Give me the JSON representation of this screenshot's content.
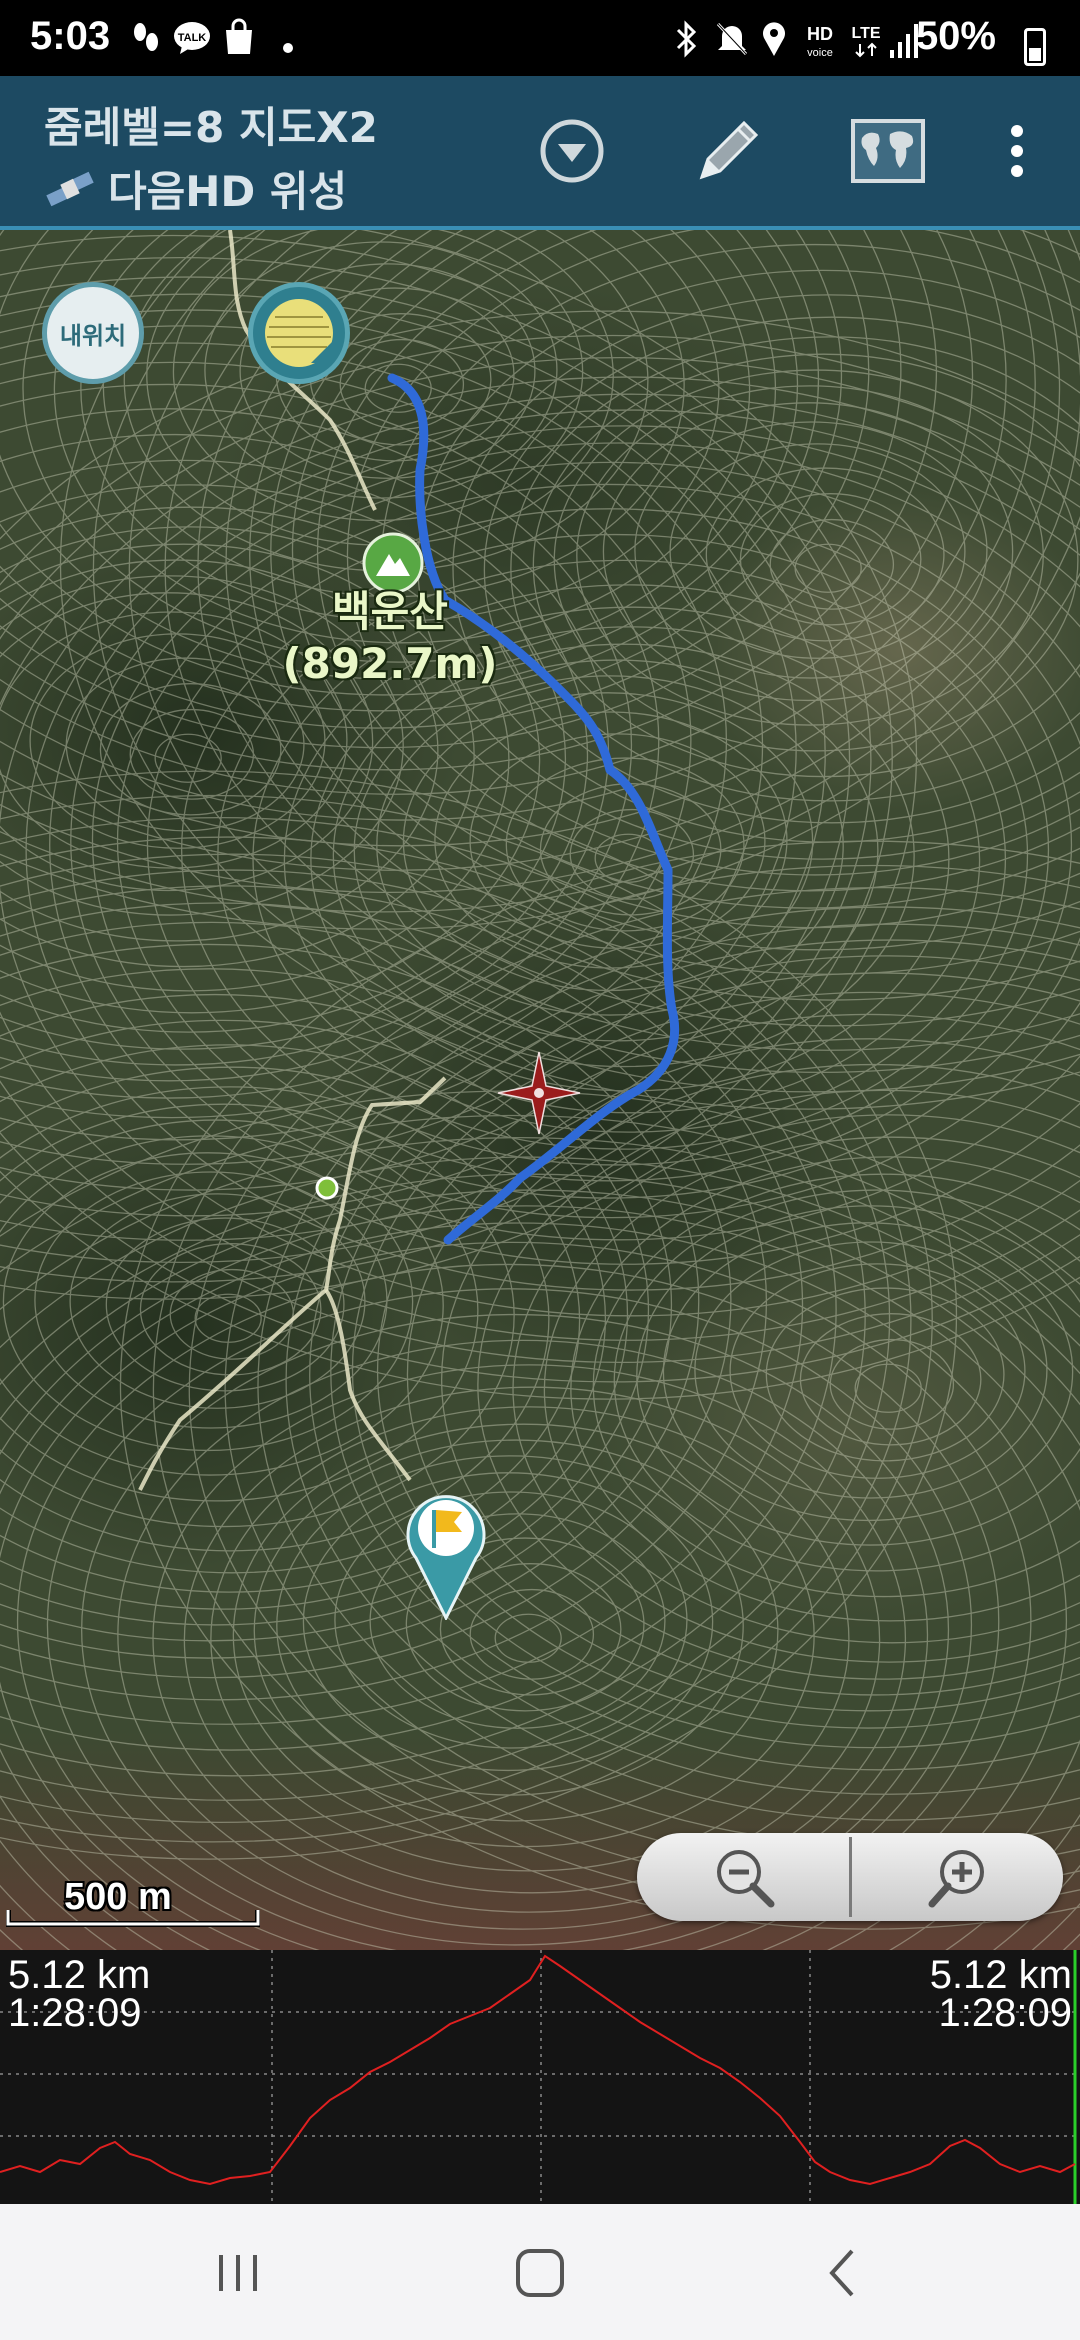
{
  "status_bar": {
    "time": "5:03",
    "battery": "50%",
    "icons": [
      "footprints-icon",
      "kakaotalk-icon",
      "shopping-bag-icon",
      "dot-icon",
      "bluetooth-icon",
      "mute-icon",
      "location-icon",
      "hd-voice-icon",
      "lte-icon",
      "signal-icon",
      "battery-icon"
    ]
  },
  "header": {
    "zoom_text": "줌레벨=8 지도X2",
    "map_source": "다음HD 위성",
    "actions": [
      "dropdown-icon",
      "pencil-icon",
      "world-map-icon",
      "more-vert-icon"
    ]
  },
  "map": {
    "my_location_label": "내위치",
    "peak_name": "백운산",
    "peak_elevation": "(892.7m)",
    "scale_label": "500 m",
    "route_color": "#2f6ad8",
    "zoom_controls": [
      "zoom-out-icon",
      "zoom-in-icon"
    ]
  },
  "profile": {
    "left_distance": "5.12 km",
    "left_time": "1:28:09",
    "right_distance": "5.12 km",
    "right_time": "1:28:09",
    "line_color": "#e02020"
  },
  "nav": [
    "recents-icon",
    "home-icon",
    "back-icon"
  ]
}
